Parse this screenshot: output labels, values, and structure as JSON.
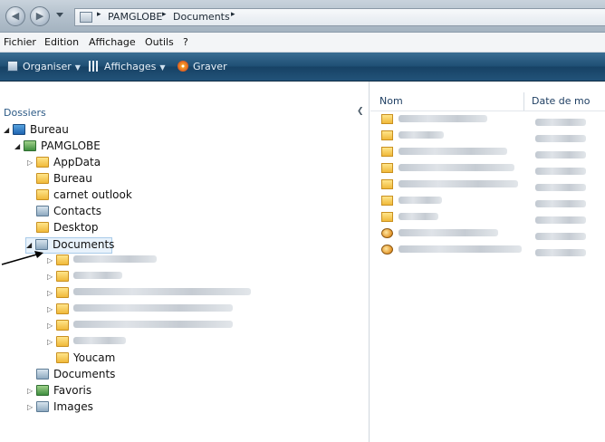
{
  "address_bar": {
    "segments": [
      "PAMGLOBE",
      "Documents"
    ],
    "separator": "▸"
  },
  "menu": [
    "Fichier",
    "Edition",
    "Affichage",
    "Outils",
    "?"
  ],
  "toolbar": {
    "organize": "Organiser",
    "views": "Affichages",
    "burn": "Graver"
  },
  "nav_pane": {
    "header": "Dossiers",
    "tree": [
      {
        "label": "Bureau",
        "icon": "desktop-icon",
        "expanded": true
      },
      {
        "label": "PAMGLOBE",
        "icon": "user-folder-icon",
        "expanded": true
      },
      {
        "label": "AppData",
        "icon": "folder-icon"
      },
      {
        "label": "Bureau",
        "icon": "folder-icon"
      },
      {
        "label": "carnet outlook",
        "icon": "folder-icon"
      },
      {
        "label": "Contacts",
        "icon": "contacts-folder-icon"
      },
      {
        "label": "Desktop",
        "icon": "folder-icon"
      },
      {
        "label": "Documents",
        "icon": "documents-folder-icon",
        "selected": true,
        "expanded": true
      },
      {
        "label": "",
        "icon": "folder-icon",
        "blurred": true
      },
      {
        "label": "",
        "icon": "folder-icon",
        "blurred": true
      },
      {
        "label": "",
        "icon": "folder-icon",
        "blurred": true
      },
      {
        "label": "",
        "icon": "folder-icon",
        "blurred": true
      },
      {
        "label": "",
        "icon": "folder-icon",
        "blurred": true
      },
      {
        "label": "",
        "icon": "folder-icon",
        "blurred": true
      },
      {
        "label": "Youcam",
        "icon": "folder-icon"
      },
      {
        "label": "Documents",
        "icon": "documents-folder-icon"
      },
      {
        "label": "Favoris",
        "icon": "favorites-folder-icon"
      },
      {
        "label": "Images",
        "icon": "pictures-folder-icon"
      }
    ]
  },
  "file_list": {
    "columns": [
      "Nom",
      "Date de mo"
    ],
    "items": [
      {
        "type": "folder"
      },
      {
        "type": "folder"
      },
      {
        "type": "folder"
      },
      {
        "type": "folder"
      },
      {
        "type": "folder"
      },
      {
        "type": "folder"
      },
      {
        "type": "folder"
      },
      {
        "type": "exe"
      },
      {
        "type": "exe"
      }
    ]
  }
}
